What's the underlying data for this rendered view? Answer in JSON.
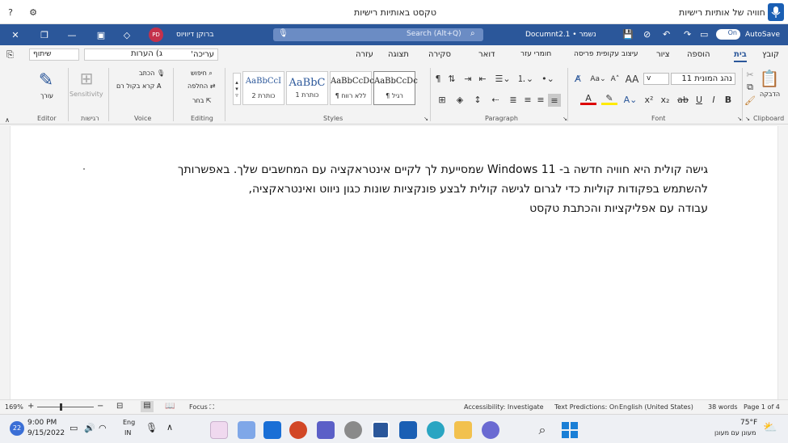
{
  "voice_bar": {
    "right_title": "חוויה של אותיות רישיות",
    "center_title": "טקסט באותיות רישיות"
  },
  "titlebar": {
    "autosave_label": "AutoSave",
    "autosave_state": "On",
    "doc_name": "Documnt2.1 • נשמר",
    "search_placeholder": "Search (Alt+Q)",
    "user_name": "ברוקן דיוויוס",
    "user_initials": "PD"
  },
  "tabs": [
    "קובץ",
    "בית",
    "הוספה",
    "ציור",
    "עיצוב עקופית",
    "פריסה",
    "חומרי עזר",
    "דואר",
    "סקירה",
    "תצוגה",
    "עזרה"
  ],
  "tabs_right": {
    "comments": "ג) הערות",
    "editing": "'עריכה",
    "share": "שיתוף"
  },
  "ribbon": {
    "clipboard": {
      "paste": "הדבקה",
      "label": "Clipboard"
    },
    "font": {
      "name": "נהג המונית 11",
      "size": "v",
      "label": "Font"
    },
    "paragraph": {
      "label": "Paragraph"
    },
    "styles": {
      "label": "Styles",
      "items": [
        {
          "preview": "AaBbCcDc",
          "name": "¶ רגיל"
        },
        {
          "preview": "AaBbCcDc",
          "name": "¶ ללא רווח"
        },
        {
          "preview": "AaBbC",
          "name": "כותרת 1"
        },
        {
          "preview": "AaBbCcI",
          "name": "כותרת 2"
        }
      ]
    },
    "editing": {
      "find": "חיפוש",
      "replace": "החלפה",
      "select": "בחר",
      "label": "Editing"
    },
    "voice": {
      "dictate": "הכתב",
      "read": "קרא בקול רם",
      "label": "Voice"
    },
    "sensitivity": {
      "name": "Sensitivity",
      "label": "רגישות"
    },
    "editor": {
      "name": "עורך",
      "label": "Editor"
    }
  },
  "document": {
    "lines": [
      "גישה קולית היא חוויה חדשה ב- Windows 11 שמסייעת לך לקיים אינטראקציה עם המחשבים שלך. באפשרותך",
      "להשתמש בפקודות קוליות כדי לגרום לגישה קולית לבצע פונקציות שונות כגון ניווט ואינטראקציה,",
      "עבודה עם אפליקציות והכתבת טקסט"
    ]
  },
  "statusbar": {
    "page": "Page 1 of 4",
    "words": "38 words",
    "language": "English (United States)",
    "predictions": "Text Predictions: On",
    "accessibility": "Accessibility: Investigate",
    "focus": "Focus",
    "zoom": "169%"
  },
  "taskbar": {
    "weather_temp": "75°F",
    "weather_desc": "מעונן עם מעונן",
    "time": "9:00 PM",
    "date": "9/15/2022",
    "lang_top": "Eng",
    "lang_bottom": "IN",
    "badge": "22"
  }
}
